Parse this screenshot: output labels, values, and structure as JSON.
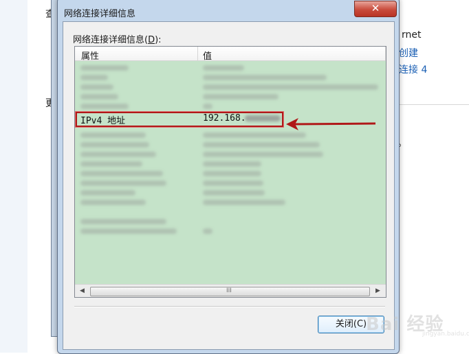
{
  "background": {
    "left_char_1": "查",
    "left_char_2": "更",
    "right_lines": [
      "rnet",
      "创建",
      "连接 4"
    ],
    "right_dot": "。"
  },
  "dialog": {
    "title": "网络连接详细信息",
    "close_glyph": "✕",
    "group_label_prefix": "网络连接详细信息(",
    "group_label_mnemonic": "D",
    "group_label_suffix": "):",
    "columns": [
      "属性",
      "值"
    ],
    "highlighted_row": {
      "property": "IPv4 地址",
      "value": "192.168."
    },
    "scrollbar": {
      "left_arrow": "◀",
      "right_arrow": "▶",
      "grip": "III"
    },
    "close_button_label": "关闭(C)"
  },
  "annotation": {
    "color": "#b01818"
  },
  "watermark": {
    "text": "Bai 经验",
    "sub": "jingyan.baidu.com"
  }
}
